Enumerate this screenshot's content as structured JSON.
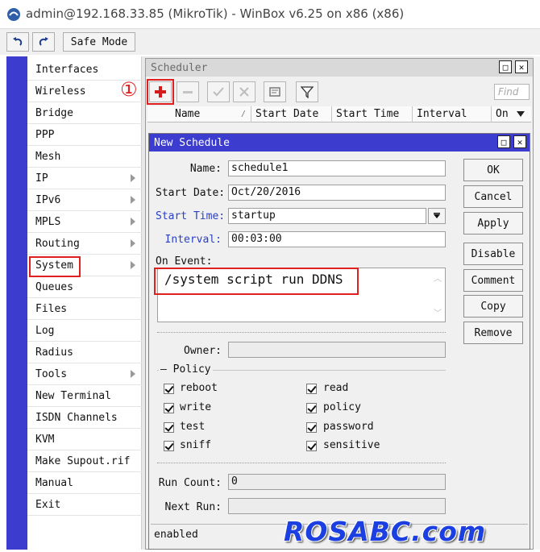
{
  "window": {
    "title": "admin@192.168.33.85 (MikroTik) - WinBox v6.25 on x86 (x86)"
  },
  "toolbar": {
    "undo_icon": "undo-icon",
    "redo_icon": "redo-icon",
    "safe_mode_label": "Safe Mode"
  },
  "sidebar": {
    "items": [
      {
        "label": "Interfaces",
        "submenu": false
      },
      {
        "label": "Wireless",
        "submenu": false
      },
      {
        "label": "Bridge",
        "submenu": false
      },
      {
        "label": "PPP",
        "submenu": false
      },
      {
        "label": "Mesh",
        "submenu": false
      },
      {
        "label": "IP",
        "submenu": true
      },
      {
        "label": "IPv6",
        "submenu": true
      },
      {
        "label": "MPLS",
        "submenu": true
      },
      {
        "label": "Routing",
        "submenu": true
      },
      {
        "label": "System",
        "submenu": true,
        "highlighted": true
      },
      {
        "label": "Queues",
        "submenu": false
      },
      {
        "label": "Files",
        "submenu": false
      },
      {
        "label": "Log",
        "submenu": false
      },
      {
        "label": "Radius",
        "submenu": false
      },
      {
        "label": "Tools",
        "submenu": true
      },
      {
        "label": "New Terminal",
        "submenu": false
      },
      {
        "label": "ISDN Channels",
        "submenu": false
      },
      {
        "label": "KVM",
        "submenu": false
      },
      {
        "label": "Make Supout.rif",
        "submenu": false
      },
      {
        "label": "Manual",
        "submenu": false
      },
      {
        "label": "Exit",
        "submenu": false
      }
    ]
  },
  "scheduler": {
    "title": "Scheduler",
    "annotation_marker": "①",
    "find_placeholder": "Find",
    "columns": [
      "Name",
      "Start Date",
      "Start Time",
      "Interval",
      "On"
    ]
  },
  "dialog": {
    "title": "New Schedule",
    "fields": {
      "name": {
        "label": "Name:",
        "value": "schedule1"
      },
      "start_date": {
        "label": "Start Date:",
        "value": "Oct/20/2016"
      },
      "start_time": {
        "label": "Start Time:",
        "value": "startup"
      },
      "interval": {
        "label": "Interval:",
        "value": "00:03:00"
      },
      "on_event": {
        "label": "On Event:",
        "value": "/system script run DDNS"
      },
      "owner": {
        "label": "Owner:",
        "value": ""
      },
      "run_count": {
        "label": "Run Count:",
        "value": "0"
      },
      "next_run": {
        "label": "Next Run:",
        "value": ""
      }
    },
    "policy": {
      "label": "Policy",
      "items": [
        {
          "label": "reboot",
          "checked": true
        },
        {
          "label": "read",
          "checked": true
        },
        {
          "label": "write",
          "checked": true
        },
        {
          "label": "policy",
          "checked": true
        },
        {
          "label": "test",
          "checked": true
        },
        {
          "label": "password",
          "checked": true
        },
        {
          "label": "sniff",
          "checked": true
        },
        {
          "label": "sensitive",
          "checked": true
        }
      ]
    },
    "buttons": {
      "ok": "OK",
      "cancel": "Cancel",
      "apply": "Apply",
      "disable": "Disable",
      "comment": "Comment",
      "copy": "Copy",
      "remove": "Remove"
    },
    "status": "enabled"
  },
  "watermark": "ROSABC.com",
  "colors": {
    "accent": "#3c3cce",
    "highlight": "#e0201f",
    "label_blue": "#2a40c8"
  }
}
